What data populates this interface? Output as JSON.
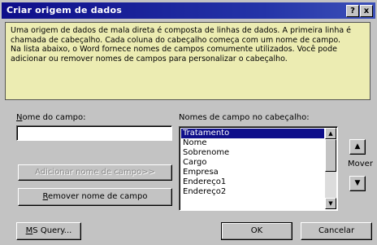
{
  "dialog": {
    "title": "Criar origem de dados",
    "help_label": "?",
    "close_label": "x"
  },
  "description": {
    "line1": "Uma origem de dados de mala direta é composta de linhas de dados. A primeira linha é chamada de cabeçalho. Cada coluna do cabeçalho começa com um nome de campo.",
    "line2": "Na lista abaixo, o Word fornece nomes de campos comumente utilizados. Você pode adicionar ou remover nomes de campos para personalizar o cabeçalho."
  },
  "field_name": {
    "label_hotkey": "N",
    "label_rest": "ome do campo:",
    "value": ""
  },
  "header_fields": {
    "label": "Nomes de campo no cabeçalho:",
    "items": [
      "Tratamento",
      "Nome",
      "Sobrenome",
      "Cargo",
      "Empresa",
      "Endereço1",
      "Endereço2"
    ],
    "selected_index": 0
  },
  "buttons": {
    "add_label": "Adicionar nome de campo>>",
    "remove_hotkey": "R",
    "remove_rest": "emover nome de campo",
    "ms_query_hotkey": "M",
    "ms_query_rest": "S Query...",
    "ok_label": "OK",
    "cancel_label": "Cancelar"
  },
  "move": {
    "label": "Mover",
    "up_icon": "up-arrow-icon",
    "down_icon": "down-arrow-icon"
  },
  "scrollbar": {
    "up_icon": "scroll-up-icon",
    "down_icon": "scroll-down-icon"
  },
  "colors": {
    "titlebar": "#0e0e8a",
    "description_bg": "#ececb2",
    "dialog_bg": "#c3c3c3",
    "selection": "#0e0e8a"
  }
}
